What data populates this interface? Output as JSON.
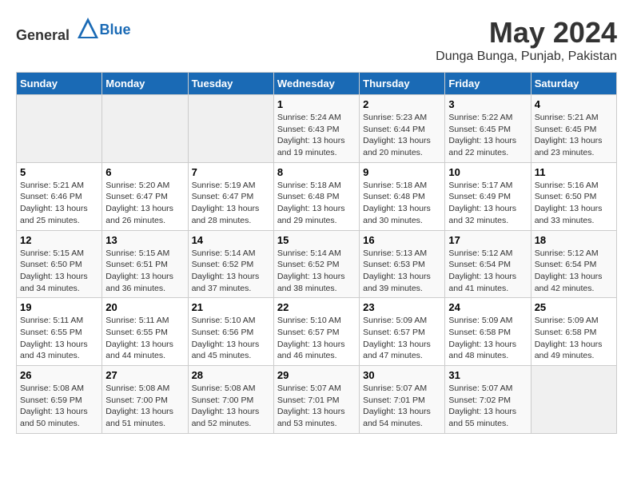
{
  "header": {
    "logo_general": "General",
    "logo_blue": "Blue",
    "title": "May 2024",
    "subtitle": "Dunga Bunga, Punjab, Pakistan"
  },
  "weekdays": [
    "Sunday",
    "Monday",
    "Tuesday",
    "Wednesday",
    "Thursday",
    "Friday",
    "Saturday"
  ],
  "weeks": [
    [
      {
        "day": "",
        "sunrise": "",
        "sunset": "",
        "daylight": "",
        "empty": true
      },
      {
        "day": "",
        "sunrise": "",
        "sunset": "",
        "daylight": "",
        "empty": true
      },
      {
        "day": "",
        "sunrise": "",
        "sunset": "",
        "daylight": "",
        "empty": true
      },
      {
        "day": "1",
        "sunrise": "Sunrise: 5:24 AM",
        "sunset": "Sunset: 6:43 PM",
        "daylight": "Daylight: 13 hours and 19 minutes."
      },
      {
        "day": "2",
        "sunrise": "Sunrise: 5:23 AM",
        "sunset": "Sunset: 6:44 PM",
        "daylight": "Daylight: 13 hours and 20 minutes."
      },
      {
        "day": "3",
        "sunrise": "Sunrise: 5:22 AM",
        "sunset": "Sunset: 6:45 PM",
        "daylight": "Daylight: 13 hours and 22 minutes."
      },
      {
        "day": "4",
        "sunrise": "Sunrise: 5:21 AM",
        "sunset": "Sunset: 6:45 PM",
        "daylight": "Daylight: 13 hours and 23 minutes."
      }
    ],
    [
      {
        "day": "5",
        "sunrise": "Sunrise: 5:21 AM",
        "sunset": "Sunset: 6:46 PM",
        "daylight": "Daylight: 13 hours and 25 minutes."
      },
      {
        "day": "6",
        "sunrise": "Sunrise: 5:20 AM",
        "sunset": "Sunset: 6:47 PM",
        "daylight": "Daylight: 13 hours and 26 minutes."
      },
      {
        "day": "7",
        "sunrise": "Sunrise: 5:19 AM",
        "sunset": "Sunset: 6:47 PM",
        "daylight": "Daylight: 13 hours and 28 minutes."
      },
      {
        "day": "8",
        "sunrise": "Sunrise: 5:18 AM",
        "sunset": "Sunset: 6:48 PM",
        "daylight": "Daylight: 13 hours and 29 minutes."
      },
      {
        "day": "9",
        "sunrise": "Sunrise: 5:18 AM",
        "sunset": "Sunset: 6:48 PM",
        "daylight": "Daylight: 13 hours and 30 minutes."
      },
      {
        "day": "10",
        "sunrise": "Sunrise: 5:17 AM",
        "sunset": "Sunset: 6:49 PM",
        "daylight": "Daylight: 13 hours and 32 minutes."
      },
      {
        "day": "11",
        "sunrise": "Sunrise: 5:16 AM",
        "sunset": "Sunset: 6:50 PM",
        "daylight": "Daylight: 13 hours and 33 minutes."
      }
    ],
    [
      {
        "day": "12",
        "sunrise": "Sunrise: 5:15 AM",
        "sunset": "Sunset: 6:50 PM",
        "daylight": "Daylight: 13 hours and 34 minutes."
      },
      {
        "day": "13",
        "sunrise": "Sunrise: 5:15 AM",
        "sunset": "Sunset: 6:51 PM",
        "daylight": "Daylight: 13 hours and 36 minutes."
      },
      {
        "day": "14",
        "sunrise": "Sunrise: 5:14 AM",
        "sunset": "Sunset: 6:52 PM",
        "daylight": "Daylight: 13 hours and 37 minutes."
      },
      {
        "day": "15",
        "sunrise": "Sunrise: 5:14 AM",
        "sunset": "Sunset: 6:52 PM",
        "daylight": "Daylight: 13 hours and 38 minutes."
      },
      {
        "day": "16",
        "sunrise": "Sunrise: 5:13 AM",
        "sunset": "Sunset: 6:53 PM",
        "daylight": "Daylight: 13 hours and 39 minutes."
      },
      {
        "day": "17",
        "sunrise": "Sunrise: 5:12 AM",
        "sunset": "Sunset: 6:54 PM",
        "daylight": "Daylight: 13 hours and 41 minutes."
      },
      {
        "day": "18",
        "sunrise": "Sunrise: 5:12 AM",
        "sunset": "Sunset: 6:54 PM",
        "daylight": "Daylight: 13 hours and 42 minutes."
      }
    ],
    [
      {
        "day": "19",
        "sunrise": "Sunrise: 5:11 AM",
        "sunset": "Sunset: 6:55 PM",
        "daylight": "Daylight: 13 hours and 43 minutes."
      },
      {
        "day": "20",
        "sunrise": "Sunrise: 5:11 AM",
        "sunset": "Sunset: 6:55 PM",
        "daylight": "Daylight: 13 hours and 44 minutes."
      },
      {
        "day": "21",
        "sunrise": "Sunrise: 5:10 AM",
        "sunset": "Sunset: 6:56 PM",
        "daylight": "Daylight: 13 hours and 45 minutes."
      },
      {
        "day": "22",
        "sunrise": "Sunrise: 5:10 AM",
        "sunset": "Sunset: 6:57 PM",
        "daylight": "Daylight: 13 hours and 46 minutes."
      },
      {
        "day": "23",
        "sunrise": "Sunrise: 5:09 AM",
        "sunset": "Sunset: 6:57 PM",
        "daylight": "Daylight: 13 hours and 47 minutes."
      },
      {
        "day": "24",
        "sunrise": "Sunrise: 5:09 AM",
        "sunset": "Sunset: 6:58 PM",
        "daylight": "Daylight: 13 hours and 48 minutes."
      },
      {
        "day": "25",
        "sunrise": "Sunrise: 5:09 AM",
        "sunset": "Sunset: 6:58 PM",
        "daylight": "Daylight: 13 hours and 49 minutes."
      }
    ],
    [
      {
        "day": "26",
        "sunrise": "Sunrise: 5:08 AM",
        "sunset": "Sunset: 6:59 PM",
        "daylight": "Daylight: 13 hours and 50 minutes."
      },
      {
        "day": "27",
        "sunrise": "Sunrise: 5:08 AM",
        "sunset": "Sunset: 7:00 PM",
        "daylight": "Daylight: 13 hours and 51 minutes."
      },
      {
        "day": "28",
        "sunrise": "Sunrise: 5:08 AM",
        "sunset": "Sunset: 7:00 PM",
        "daylight": "Daylight: 13 hours and 52 minutes."
      },
      {
        "day": "29",
        "sunrise": "Sunrise: 5:07 AM",
        "sunset": "Sunset: 7:01 PM",
        "daylight": "Daylight: 13 hours and 53 minutes."
      },
      {
        "day": "30",
        "sunrise": "Sunrise: 5:07 AM",
        "sunset": "Sunset: 7:01 PM",
        "daylight": "Daylight: 13 hours and 54 minutes."
      },
      {
        "day": "31",
        "sunrise": "Sunrise: 5:07 AM",
        "sunset": "Sunset: 7:02 PM",
        "daylight": "Daylight: 13 hours and 55 minutes."
      },
      {
        "day": "",
        "sunrise": "",
        "sunset": "",
        "daylight": "",
        "empty": true
      }
    ]
  ]
}
